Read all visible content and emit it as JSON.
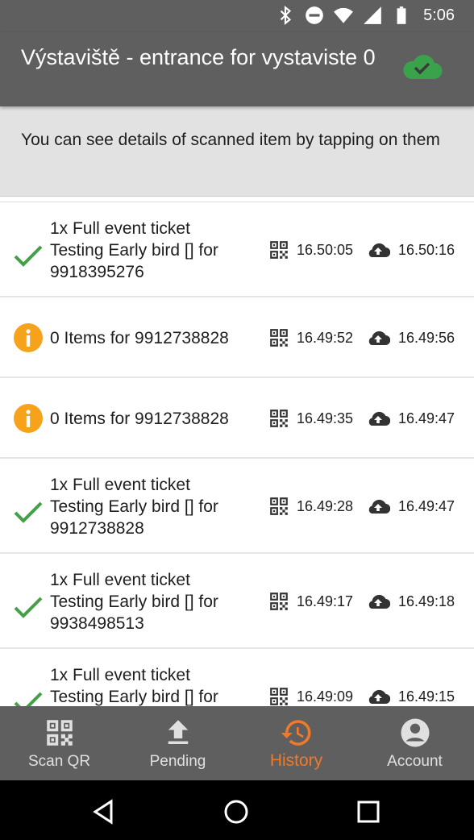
{
  "status_bar": {
    "time": "5:06"
  },
  "app_bar": {
    "title": "Výstaviště - entrance for vystaviste 0",
    "sync_icon": "cloud-check-icon",
    "sync_color": "#3aa24a"
  },
  "notice": {
    "text": "You can see details of scanned item by tapping on them"
  },
  "colors": {
    "success": "#43a047",
    "info": "#f7a21b",
    "accent": "#ef7a2a",
    "bar": "#5f5f5f"
  },
  "history": [
    {
      "status": "success",
      "lines": [
        "1x Full event ticket",
        "Testing Early bird [] for",
        "9918395276"
      ],
      "scanned": "16.50:05",
      "uploaded": "16.50:16"
    },
    {
      "status": "info",
      "lines": [
        "0 Items for 9912738828"
      ],
      "scanned": "16.49:52",
      "uploaded": "16.49:56"
    },
    {
      "status": "info",
      "lines": [
        "0 Items for 9912738828"
      ],
      "scanned": "16.49:35",
      "uploaded": "16.49:47"
    },
    {
      "status": "success",
      "lines": [
        "1x Full event ticket",
        "Testing Early bird [] for",
        "9912738828"
      ],
      "scanned": "16.49:28",
      "uploaded": "16.49:47"
    },
    {
      "status": "success",
      "lines": [
        "1x Full event ticket",
        "Testing Early bird [] for",
        "9938498513"
      ],
      "scanned": "16.49:17",
      "uploaded": "16.49:18"
    },
    {
      "status": "success",
      "lines": [
        "1x Full event ticket",
        "Testing Early bird [] for",
        ""
      ],
      "scanned": "16.49:09",
      "uploaded": "16.49:15"
    }
  ],
  "bottom_nav": [
    {
      "label": "Scan QR",
      "icon": "qr-code-icon",
      "active": false
    },
    {
      "label": "Pending",
      "icon": "upload-icon",
      "active": false
    },
    {
      "label": "History",
      "icon": "history-icon",
      "active": true
    },
    {
      "label": "Account",
      "icon": "account-icon",
      "active": false
    }
  ]
}
